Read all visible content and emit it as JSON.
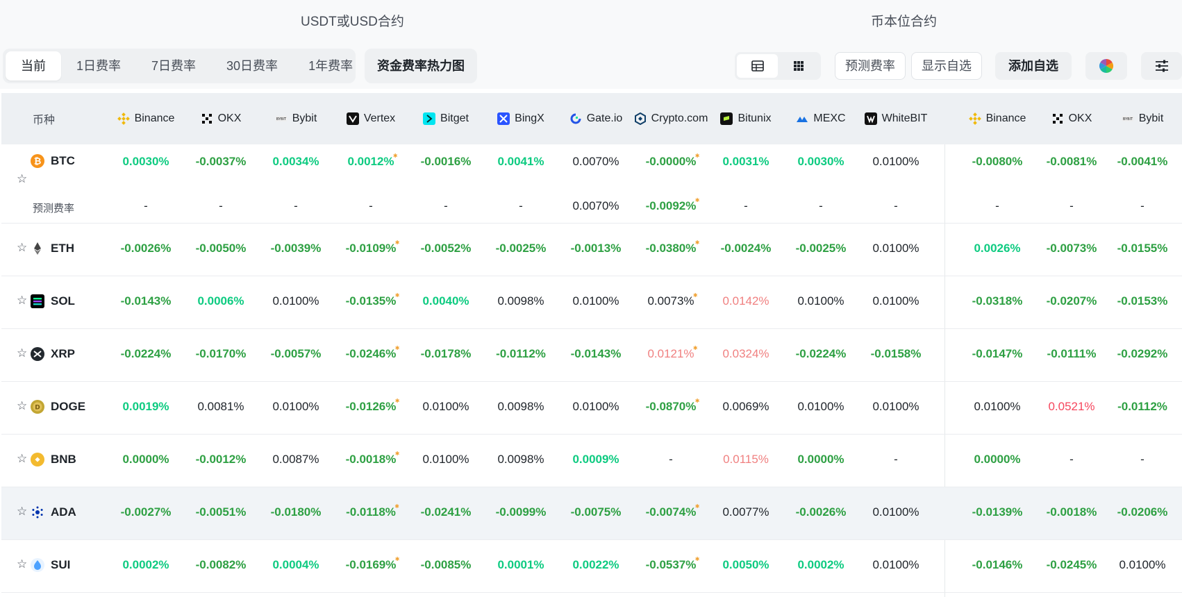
{
  "sections": {
    "usdt": "USDT或USD合约",
    "coin": "币本位合约"
  },
  "tabs": [
    {
      "label": "当前",
      "active": true
    },
    {
      "label": "1日费率",
      "active": false
    },
    {
      "label": "7日费率",
      "active": false
    },
    {
      "label": "30日费率",
      "active": false
    },
    {
      "label": "1年费率",
      "active": false
    }
  ],
  "toolbar": {
    "heatmap": "资金费率热力图",
    "view_table_icon": "table-icon",
    "view_grid_icon": "grid-icon",
    "predict": "预测费率",
    "show_fav": "显示自选",
    "add_fav": "添加自选",
    "color_icon": "color-wheel-icon",
    "settings_icon": "sliders-icon"
  },
  "table": {
    "coin_header": "币种",
    "predicted_label": "预测费率",
    "exchanges": [
      {
        "name": "Binance",
        "color": "#f0b90b",
        "icon": "binance-icon"
      },
      {
        "name": "OKX",
        "color": "#000000",
        "icon": "okx-icon"
      },
      {
        "name": "Bybit",
        "color": "#1a1a1a",
        "icon": "bybit-icon"
      },
      {
        "name": "Vertex",
        "color": "#111111",
        "icon": "vertex-icon"
      },
      {
        "name": "Bitget",
        "color": "#00f0ff",
        "icon": "bitget-icon"
      },
      {
        "name": "BingX",
        "color": "#2a54ff",
        "icon": "bingx-icon"
      },
      {
        "name": "Gate.io",
        "color": "#2354e6",
        "icon": "gate-icon"
      },
      {
        "name": "Crypto.com",
        "color": "#103f68",
        "icon": "cryptocom-icon"
      },
      {
        "name": "Bitunix",
        "color": "#111111",
        "icon": "bitunix-icon"
      },
      {
        "name": "MEXC",
        "color": "#1972e2",
        "icon": "mexc-icon"
      },
      {
        "name": "WhiteBIT",
        "color": "#111111",
        "icon": "whitebit-icon"
      },
      {
        "name": "Binance",
        "color": "#f0b90b",
        "icon": "binance-icon"
      },
      {
        "name": "OKX",
        "color": "#000000",
        "icon": "okx-icon"
      },
      {
        "name": "Bybit",
        "color": "#1a1a1a",
        "icon": "bybit-icon"
      }
    ],
    "rows": [
      {
        "coin": "BTC",
        "color": "#f7931a",
        "icon": "btc-icon",
        "shade": false,
        "values": [
          [
            "0.0030%",
            "pos"
          ],
          [
            "-0.0037%",
            "neg"
          ],
          [
            "0.0034%",
            "pos"
          ],
          [
            "0.0012%",
            "pos",
            1
          ],
          [
            "-0.0016%",
            "neg"
          ],
          [
            "0.0041%",
            "pos"
          ],
          [
            "0.0070%",
            "neu"
          ],
          [
            "-0.0000%",
            "neg",
            1
          ],
          [
            "0.0031%",
            "pos"
          ],
          [
            "0.0030%",
            "pos"
          ],
          [
            "0.0100%",
            "neu"
          ],
          [
            "-0.0080%",
            "neg"
          ],
          [
            "-0.0081%",
            "neg"
          ],
          [
            "-0.0041%",
            "neg"
          ]
        ],
        "predicted": [
          [
            "-",
            "neu"
          ],
          [
            "-",
            "neu"
          ],
          [
            "-",
            "neu"
          ],
          [
            "-",
            "neu"
          ],
          [
            "-",
            "neu"
          ],
          [
            "-",
            "neu"
          ],
          [
            "0.0070%",
            "neu"
          ],
          [
            "-0.0092%",
            "neg",
            1
          ],
          [
            "-",
            "neu"
          ],
          [
            "-",
            "neu"
          ],
          [
            "-",
            "neu"
          ],
          [
            "-",
            "neu"
          ],
          [
            "-",
            "neu"
          ],
          [
            "-",
            "neu"
          ]
        ]
      },
      {
        "coin": "ETH",
        "color": "#627eea",
        "icon": "eth-icon",
        "shade": false,
        "values": [
          [
            "-0.0026%",
            "neg"
          ],
          [
            "-0.0050%",
            "neg"
          ],
          [
            "-0.0039%",
            "neg"
          ],
          [
            "-0.0109%",
            "neg",
            1
          ],
          [
            "-0.0052%",
            "neg"
          ],
          [
            "-0.0025%",
            "neg"
          ],
          [
            "-0.0013%",
            "neg"
          ],
          [
            "-0.0380%",
            "neg",
            1
          ],
          [
            "-0.0024%",
            "neg"
          ],
          [
            "-0.0025%",
            "neg"
          ],
          [
            "0.0100%",
            "neu"
          ],
          [
            "0.0026%",
            "pos"
          ],
          [
            "-0.0073%",
            "neg"
          ],
          [
            "-0.0155%",
            "neg"
          ]
        ]
      },
      {
        "coin": "SOL",
        "color": "#14f195",
        "icon": "sol-icon",
        "shade": false,
        "values": [
          [
            "-0.0143%",
            "neg"
          ],
          [
            "0.0006%",
            "pos"
          ],
          [
            "0.0100%",
            "neu"
          ],
          [
            "-0.0135%",
            "neg",
            1
          ],
          [
            "0.0040%",
            "pos"
          ],
          [
            "0.0098%",
            "neu"
          ],
          [
            "0.0100%",
            "neu"
          ],
          [
            "0.0073%",
            "neu",
            1
          ],
          [
            "0.0142%",
            "pink"
          ],
          [
            "0.0100%",
            "neu"
          ],
          [
            "0.0100%",
            "neu"
          ],
          [
            "-0.0318%",
            "neg"
          ],
          [
            "-0.0207%",
            "neg"
          ],
          [
            "-0.0153%",
            "neg"
          ]
        ]
      },
      {
        "coin": "XRP",
        "color": "#23292f",
        "icon": "xrp-icon",
        "shade": false,
        "values": [
          [
            "-0.0224%",
            "neg"
          ],
          [
            "-0.0170%",
            "neg"
          ],
          [
            "-0.0057%",
            "neg"
          ],
          [
            "-0.0246%",
            "neg",
            1
          ],
          [
            "-0.0178%",
            "neg"
          ],
          [
            "-0.0112%",
            "neg"
          ],
          [
            "-0.0143%",
            "neg"
          ],
          [
            "0.0121%",
            "pink",
            1
          ],
          [
            "0.0324%",
            "pink"
          ],
          [
            "-0.0224%",
            "neg"
          ],
          [
            "-0.0158%",
            "neg"
          ],
          [
            "-0.0147%",
            "neg"
          ],
          [
            "-0.0111%",
            "neg"
          ],
          [
            "-0.0292%",
            "neg"
          ]
        ]
      },
      {
        "coin": "DOGE",
        "color": "#c2a633",
        "icon": "doge-icon",
        "shade": false,
        "values": [
          [
            "0.0019%",
            "pos"
          ],
          [
            "0.0081%",
            "neu"
          ],
          [
            "0.0100%",
            "neu"
          ],
          [
            "-0.0126%",
            "neg",
            1
          ],
          [
            "0.0100%",
            "neu"
          ],
          [
            "0.0098%",
            "neu"
          ],
          [
            "0.0100%",
            "neu"
          ],
          [
            "-0.0870%",
            "neg",
            1
          ],
          [
            "0.0069%",
            "neu"
          ],
          [
            "0.0100%",
            "neu"
          ],
          [
            "0.0100%",
            "neu"
          ],
          [
            "0.0100%",
            "neu"
          ],
          [
            "0.0521%",
            "red"
          ],
          [
            "-0.0112%",
            "neg"
          ]
        ]
      },
      {
        "coin": "BNB",
        "color": "#f3ba2f",
        "icon": "bnb-icon",
        "shade": false,
        "values": [
          [
            "0.0000%",
            "neg"
          ],
          [
            "-0.0012%",
            "neg"
          ],
          [
            "0.0087%",
            "neu"
          ],
          [
            "-0.0018%",
            "neg",
            1
          ],
          [
            "0.0100%",
            "neu"
          ],
          [
            "0.0098%",
            "neu"
          ],
          [
            "0.0009%",
            "pos"
          ],
          [
            "-",
            "neu"
          ],
          [
            "0.0115%",
            "pink"
          ],
          [
            "0.0000%",
            "neg"
          ],
          [
            "-",
            "neu"
          ],
          [
            "0.0000%",
            "neg"
          ],
          [
            "-",
            "neu"
          ],
          [
            "-",
            "neu"
          ]
        ]
      },
      {
        "coin": "ADA",
        "color": "#0033ad",
        "icon": "ada-icon",
        "shade": true,
        "values": [
          [
            "-0.0027%",
            "neg"
          ],
          [
            "-0.0051%",
            "neg"
          ],
          [
            "-0.0180%",
            "neg"
          ],
          [
            "-0.0118%",
            "neg",
            1
          ],
          [
            "-0.0241%",
            "neg"
          ],
          [
            "-0.0099%",
            "neg"
          ],
          [
            "-0.0075%",
            "neg"
          ],
          [
            "-0.0074%",
            "neg",
            1
          ],
          [
            "0.0077%",
            "neu"
          ],
          [
            "-0.0026%",
            "neg"
          ],
          [
            "0.0100%",
            "neu"
          ],
          [
            "-0.0139%",
            "neg"
          ],
          [
            "-0.0018%",
            "neg"
          ],
          [
            "-0.0206%",
            "neg"
          ]
        ]
      },
      {
        "coin": "SUI",
        "color": "#4da2ff",
        "icon": "sui-icon",
        "shade": false,
        "values": [
          [
            "0.0002%",
            "pos"
          ],
          [
            "-0.0082%",
            "neg"
          ],
          [
            "0.0004%",
            "pos"
          ],
          [
            "-0.0169%",
            "neg",
            1
          ],
          [
            "-0.0085%",
            "neg"
          ],
          [
            "0.0001%",
            "pos"
          ],
          [
            "0.0022%",
            "pos"
          ],
          [
            "-0.0537%",
            "neg",
            1
          ],
          [
            "0.0050%",
            "pos"
          ],
          [
            "0.0002%",
            "pos"
          ],
          [
            "0.0100%",
            "neu"
          ],
          [
            "-0.0146%",
            "neg"
          ],
          [
            "-0.0245%",
            "neg"
          ],
          [
            "0.0100%",
            "neu"
          ]
        ]
      }
    ]
  }
}
